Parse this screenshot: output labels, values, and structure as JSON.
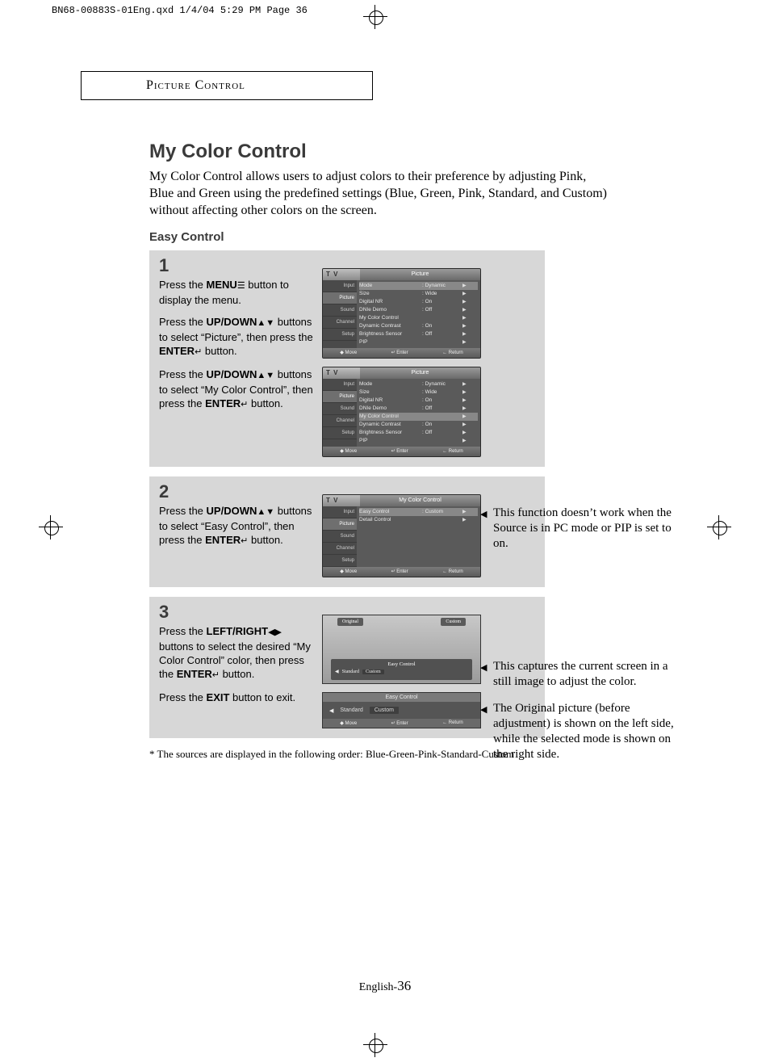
{
  "print_slug": "BN68-00883S-01Eng.qxd  1/4/04 5:29 PM  Page 36",
  "chapter": "Picture Control",
  "title": "My Color Control",
  "lede": "My Color Control allows users to adjust colors to their preference by adjusting Pink, Blue and Green using the predefined settings (Blue, Green, Pink, Standard, and Custom) without affecting other colors on the screen.",
  "subhead": "Easy Control",
  "steps": {
    "s1": {
      "num": "1",
      "p1_a": "Press the ",
      "p1_b": "MENU",
      "p1_c": " button to display the menu.",
      "p2_a": "Press the ",
      "p2_b": "UP/DOWN",
      "p2_c": " buttons to select “Picture”, then press the ",
      "p2_d": "ENTER",
      "p2_e": " button.",
      "p3_a": "Press the ",
      "p3_b": "UP/DOWN",
      "p3_c": " buttons to select “My Color Control”, then press the ",
      "p3_d": "ENTER",
      "p3_e": " button."
    },
    "s2": {
      "num": "2",
      "p1_a": "Press the ",
      "p1_b": "UP/DOWN",
      "p1_c": " buttons to select “Easy Control”, then press the ",
      "p1_d": "ENTER",
      "p1_e": " button."
    },
    "s3": {
      "num": "3",
      "p1_a": "Press the ",
      "p1_b": "LEFT/RIGHT",
      "p1_c": " buttons to select the desired “My Color Control” color, then press the ",
      "p1_d": "ENTER",
      "p1_e": " button.",
      "p2_a": "Press the ",
      "p2_b": "EXIT",
      "p2_c": " button to exit."
    }
  },
  "osd": {
    "tv": "T V",
    "sidebar": [
      "Input",
      "Picture",
      "Sound",
      "Channel",
      "Setup"
    ],
    "title_picture": "Picture",
    "title_mcc": "My Color Control",
    "rows_picture": [
      {
        "label": "Mode",
        "value": ": Dynamic"
      },
      {
        "label": "Size",
        "value": ": Wide"
      },
      {
        "label": "Digital NR",
        "value": ": On"
      },
      {
        "label": "DNIe Demo",
        "value": ": Off"
      },
      {
        "label": "My Color Control",
        "value": ""
      },
      {
        "label": "Dynamic Contrast",
        "value": ": On"
      },
      {
        "label": "Brightness Sensor",
        "value": ": Off"
      },
      {
        "label": "PIP",
        "value": ""
      }
    ],
    "rows_mcc": [
      {
        "label": "Easy Control",
        "value": ": Custom"
      },
      {
        "label": "Detail Control",
        "value": ""
      }
    ],
    "footer": {
      "move": "◆ Move",
      "enter": "↵ Enter",
      "return": "← Return"
    }
  },
  "compare": {
    "left_tag": "Original",
    "right_tag": "Custom",
    "panel_title": "Easy Control",
    "opts": [
      "Standard",
      "Custom"
    ],
    "foot": {
      "move": "◆ Move",
      "enter": "↵ Enter",
      "return": "← Return"
    }
  },
  "ecbar": {
    "title": "Easy Control",
    "opts_left": "Standard",
    "opts_sel": "Custom",
    "foot": {
      "move": "◆ Move",
      "enter": "↵ Enter",
      "return": "← Return"
    }
  },
  "notes": {
    "n1": "This function doesn’t work when the Source is in PC mode or PIP is set to on.",
    "n2a": "This captures the current screen in a still image to adjust the color.",
    "n2b": "The Original picture (before adjustment) is shown on the left side, while the selected mode is shown on the right side."
  },
  "footnote": "* The sources are displayed in the following order: Blue-Green-Pink-Standard-Custom",
  "pagelabel_prefix": "English-",
  "pagelabel_num": "36"
}
